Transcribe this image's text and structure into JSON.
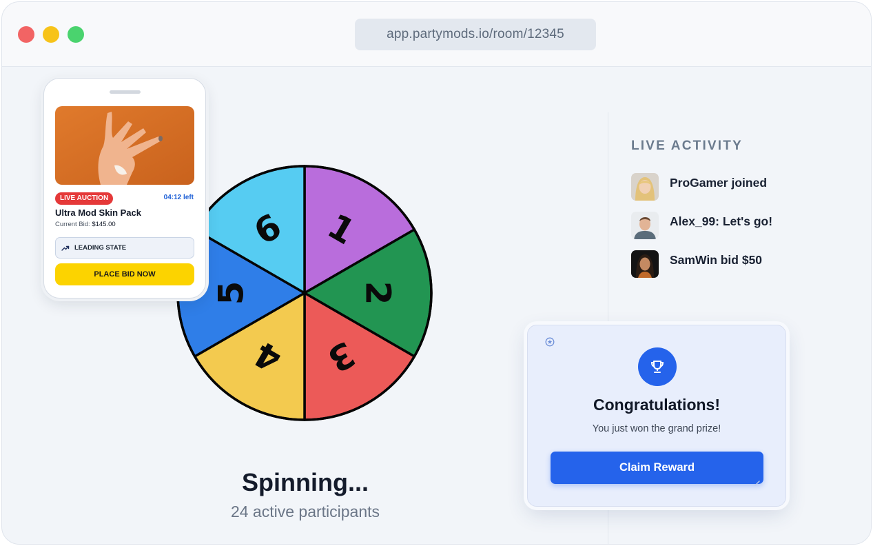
{
  "browser": {
    "url": "app.partymods.io/room/12345"
  },
  "wheel": {
    "segments": [
      {
        "label": "1",
        "color": "#b96ddc"
      },
      {
        "label": "2",
        "color": "#229552"
      },
      {
        "label": "3",
        "color": "#ec5a58"
      },
      {
        "label": "4",
        "color": "#f3ca4f"
      },
      {
        "label": "5",
        "color": "#2f7ee8"
      },
      {
        "label": "6",
        "color": "#56ccf2"
      }
    ],
    "status": "Spinning...",
    "participants": "24 active participants"
  },
  "activity": {
    "title": "LIVE ACTIVITY",
    "items": [
      {
        "text": "ProGamer joined",
        "avatar": "avatar-blonde-woman"
      },
      {
        "text": "Alex_99: Let's go!",
        "avatar": "avatar-man-sweater"
      },
      {
        "text": "SamWin bid $50",
        "avatar": "avatar-woman-dark"
      }
    ]
  },
  "auction": {
    "badge": "LIVE AUCTION",
    "timer": "04:12 left",
    "product_name": "Ultra Mod Skin Pack",
    "bid_label": "Current Bid:",
    "bid_value": "$145.00",
    "leading_state": "LEADING STATE",
    "cta": "PLACE BID NOW"
  },
  "reward": {
    "title": "Congratulations!",
    "subtitle": "You just won the grand prize!",
    "cta": "Claim Reward"
  },
  "colors": {
    "accent": "#2563eb",
    "bid_button": "#fcd300",
    "live_badge": "#e53939"
  }
}
